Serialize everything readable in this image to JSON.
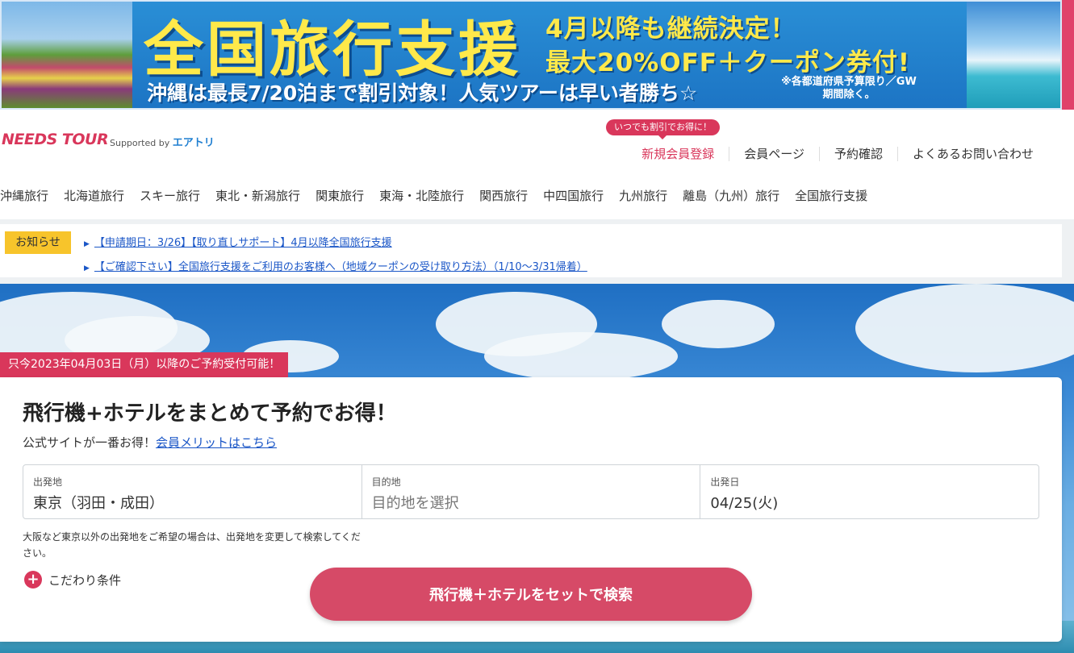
{
  "banner": {
    "title": "全国旅行支援",
    "right_line1": "4月以降も継続決定！",
    "right_line2": "最大20%OFF＋クーポン券付!",
    "subtitle": "沖縄は最長7/20泊まで割引対象！人気ツアーは早い者勝ち☆",
    "note": "※各都道府県予算限り／GW期間除く。"
  },
  "header": {
    "logo": "NEEDS TOUR",
    "supported_prefix": "Supported by",
    "supported_brand": "エアトリ",
    "promo_bubble": "いつでも割引でお得に！",
    "links": [
      "新規会員登録",
      "会員ページ",
      "予約確認",
      "よくあるお問い合わせ"
    ]
  },
  "categories": [
    "沖縄旅行",
    "北海道旅行",
    "スキー旅行",
    "東北・新潟旅行",
    "関東旅行",
    "東海・北陸旅行",
    "関西旅行",
    "中四国旅行",
    "九州旅行",
    "離島（九州）旅行",
    "全国旅行支援"
  ],
  "notice": {
    "badge": "お知らせ",
    "items": [
      "【申請期日：3/26】【取り直しサポート】4月以降全国旅行支援",
      "【ご確認下さい】全国旅行支援をご利用のお客様へ（地域クーポンの受け取り方法）（1/10〜3/31帰着）"
    ]
  },
  "hero": {
    "ribbon": "只今2023年04月03日（月）以降のご予約受付可能！"
  },
  "search": {
    "title": "飛行機+ホテルをまとめて予約でお得！",
    "subtitle_prefix": "公式サイトが一番お得！",
    "subtitle_link": "会員メリットはこちら",
    "fields": [
      {
        "label": "出発地",
        "value": "東京（羽田・成田）"
      },
      {
        "label": "目的地",
        "value": "目的地を選択"
      },
      {
        "label": "出発日",
        "value": "04/25(火)"
      }
    ],
    "note": "大阪など東京以外の出発地をご希望の場合は、出発地を変更して検索してください。",
    "conditions_label": "こだわり条件",
    "button_label": "飛行機＋ホテルをセットで検索"
  }
}
